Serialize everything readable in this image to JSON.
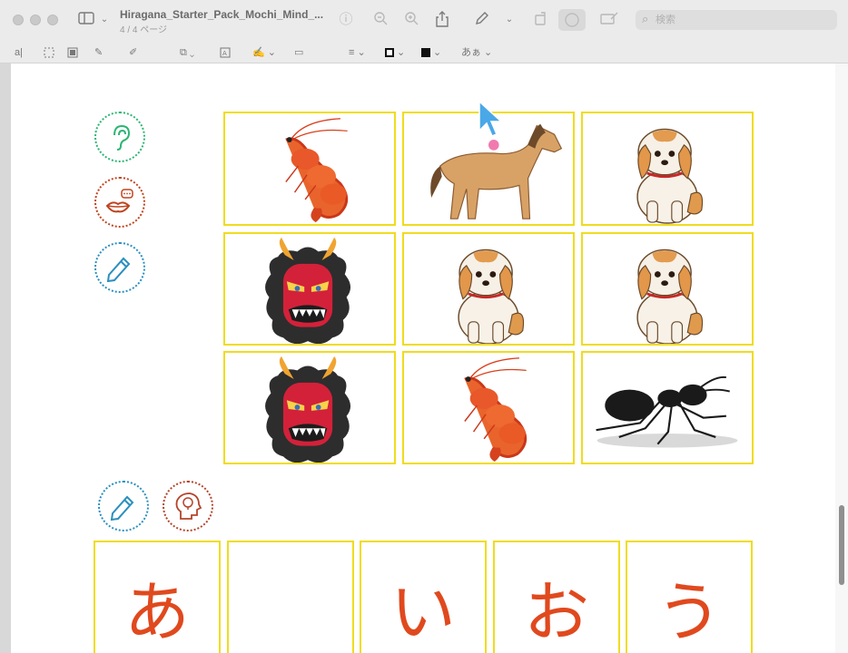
{
  "window": {
    "title": "Hiragana_Starter_Pack_Mochi_Mind_...",
    "page_indicator": "4 / 4 ページ",
    "search_placeholder": "検索"
  },
  "markup_toolbar": {
    "text_style_label": "あぁ"
  },
  "worksheet": {
    "side_icons": [
      "ear-icon",
      "lips-speech-icon",
      "pencil-icon"
    ],
    "picture_grid": [
      [
        "shrimp",
        "horse",
        "dog"
      ],
      [
        "oni-mask",
        "dog",
        "dog"
      ],
      [
        "oni-mask",
        "shrimp",
        "ant"
      ]
    ],
    "bottom_icons": [
      "pencil-icon",
      "lightbulb-head-icon"
    ],
    "kana_boxes": [
      "あ",
      "",
      "い",
      "お",
      "う"
    ]
  },
  "colors": {
    "box_border": "#f0dc1e",
    "kana_text": "#e0491e",
    "ear_icon": "#2bb673",
    "lips_icon": "#c0441e",
    "pencil_icon": "#2a8fbf",
    "idea_icon": "#b5442a"
  }
}
